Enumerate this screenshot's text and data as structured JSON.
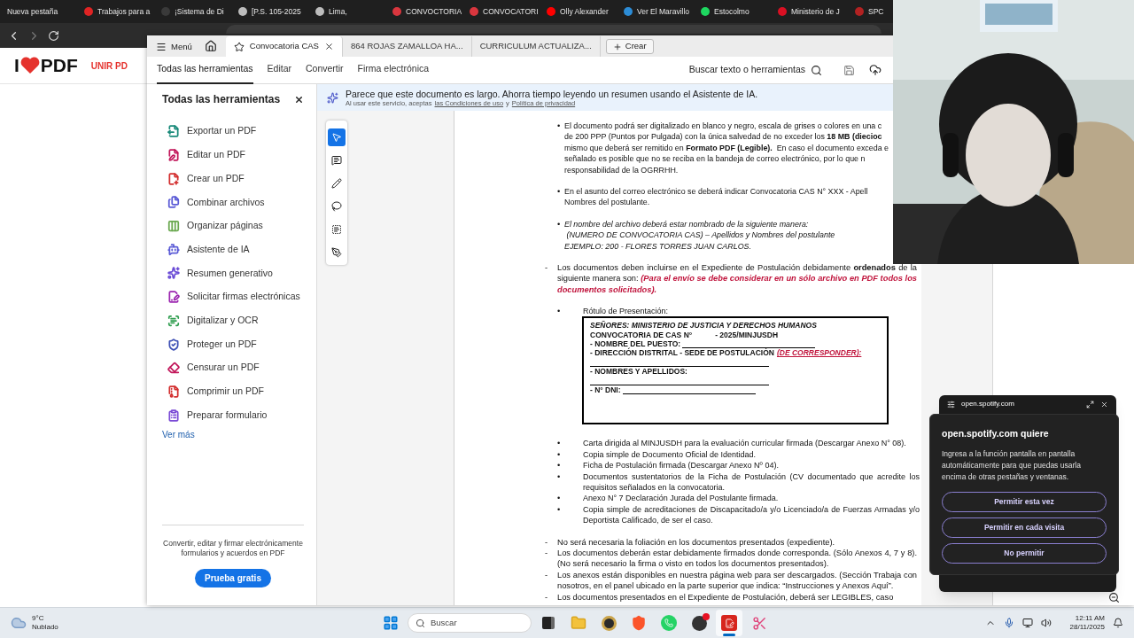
{
  "browser_tabs": [
    {
      "label": "Nueva pestaña"
    },
    {
      "label": "Trabajos para a",
      "color": "#e02424"
    },
    {
      "label": "¡Sistema de Di",
      "color": "#3a3a3a"
    },
    {
      "label": "[P.S. 105-2025",
      "color": "#bdbdbd"
    },
    {
      "label": "Lima,",
      "color": "#bdbdbd"
    },
    {
      "label": "CONVOCTORIA",
      "color": "#d9363e"
    },
    {
      "label": "CONVOCATORI",
      "color": "#d9363e"
    },
    {
      "label": "Olly Alexander",
      "color": "#ff0000"
    },
    {
      "label": "Ver El Maravillo",
      "color": "#2c8cd6"
    },
    {
      "label": "Estocolmo",
      "color": "#1ed760"
    },
    {
      "label": "Ministerio de J",
      "color": "#d91023"
    },
    {
      "label": "SPC",
      "color": "#b22222"
    }
  ],
  "site": {
    "logo_left": "I",
    "logo_right": "PDF",
    "nav_item": "UNIR PD"
  },
  "acrobat": {
    "menu_label": "Menú",
    "tabs": [
      {
        "label": "Convocatoria CAS",
        "selected": true
      },
      {
        "label": "864 ROJAS ZAMALLOA HA...",
        "selected": false
      },
      {
        "label": "CURRICULUM ACTUALIZA...",
        "selected": false
      }
    ],
    "create_button": "Crear",
    "toolbar_tabs": [
      {
        "label": "Todas las herramientas",
        "selected": true
      },
      {
        "label": "Editar",
        "selected": false
      },
      {
        "label": "Convertir",
        "selected": false
      },
      {
        "label": "Firma electrónica",
        "selected": false
      }
    ],
    "search_label": "Buscar texto o herramientas"
  },
  "sidebar": {
    "title": "Todas las herramientas",
    "items": [
      {
        "label": "Exportar un PDF",
        "kind": "export",
        "color": "#1a8a7a"
      },
      {
        "label": "Editar un PDF",
        "kind": "edit",
        "color": "#c2185b"
      },
      {
        "label": "Crear un PDF",
        "kind": "create",
        "color": "#d32f2f"
      },
      {
        "label": "Combinar archivos",
        "kind": "combine",
        "color": "#5b5bd6"
      },
      {
        "label": "Organizar páginas",
        "kind": "organize",
        "color": "#6aa84f"
      },
      {
        "label": "Asistente de IA",
        "kind": "assistant",
        "color": "#5b5bd6"
      },
      {
        "label": "Resumen generativo",
        "kind": "summary",
        "color": "#6a4bd6"
      },
      {
        "label": "Solicitar firmas electrónicas",
        "kind": "sign",
        "color": "#9c27b0"
      },
      {
        "label": "Digitalizar y OCR",
        "kind": "scan",
        "color": "#2e9d4e"
      },
      {
        "label": "Proteger un PDF",
        "kind": "protect",
        "color": "#3f51b5"
      },
      {
        "label": "Censurar un PDF",
        "kind": "redact",
        "color": "#c2185b"
      },
      {
        "label": "Comprimir un PDF",
        "kind": "compress",
        "color": "#d32f2f"
      },
      {
        "label": "Preparar formulario",
        "kind": "form",
        "color": "#7b4bd6"
      }
    ],
    "more_link": "Ver más",
    "promo": "Convertir, editar y firmar electrónicamente formularios y acuerdos en PDF",
    "cta": "Prueba gratis"
  },
  "banner": {
    "message": "Parece que este documento es largo. Ahorra tiempo leyendo un resumen usando el Asistente de IA.",
    "notice": "Al usar este servicio, aceptas",
    "terms_link": "las Condiciones de uso",
    "conjunction": "y",
    "privacy_link": "Política de privacidad"
  },
  "tool_rail": [
    {
      "kind": "select",
      "selected": true
    },
    {
      "kind": "comment",
      "selected": false
    },
    {
      "kind": "draw",
      "selected": false
    },
    {
      "kind": "lasso",
      "selected": false
    },
    {
      "kind": "text",
      "selected": false
    },
    {
      "kind": "sign",
      "selected": false
    }
  ],
  "document": {
    "blocks": [
      {
        "kind": "dot",
        "marker": "•",
        "lines": [
          "El documento podrá ser digitalizado en blanco y negro, escala de grises o colores en una c",
          "de 200 PPP (Puntos por Pulgada) con la única salvedad de no exceder los **18 MB (diecioc**",
          "mismo que deberá ser remitido en **Formato PDF (Legible).**  En caso el documento exceda e",
          "señalado es posible que no se reciba en la bandeja de correo electrónico, por lo que n",
          "responsabilidad de la OGRRHH."
        ]
      },
      {
        "kind": "dot",
        "marker": "•",
        "lines": [
          "En el asunto del correo electrónico se deberá indicar Convocatoria CAS N° XXX - Apell",
          "Nombres del postulante."
        ]
      },
      {
        "kind": "dot",
        "marker": "•",
        "italic": true,
        "lines": [
          "El nombre del archivo deberá estar nombrado de la siguiente manera:",
          " (NUMERO DE CONVOCATORIA CAS) – Apellidos y Nombres del postulante",
          "EJEMPLO: 200 - FLORES TORRES JUAN CARLOS."
        ]
      },
      {
        "kind": "dash",
        "marker": "-",
        "lines": [
          "Los documentos deben incluirse en el Expediente de Postulación debidamente **ordenados** de la",
          {
            "text": "siguiente manera son: ",
            "alert": "(Para el envío se debe considerar en un sólo archivo en PDF todos los"
          },
          {
            "alert": "documentos solicitados)."
          }
        ]
      },
      {
        "kind": "item",
        "marker": "•",
        "lines": [
          "Rótulo de Presentación:"
        ]
      },
      {
        "kind": "label_box",
        "rows": [
          {
            "text": "SEÑORES: MINISTERIO DE JUSTICIA Y DERECHOS HUMANOS",
            "italic": true
          },
          {
            "text": "CONVOCATORIA DE CAS N°",
            "suffix": "- 2025/MINJUSDH"
          },
          {
            "text": "- NOMBRE DEL PUESTO:",
            "fill_line": true
          },
          {
            "text": "- DIRECCIÓN DISTRITAL - SEDE DE POSTULACIÓN",
            "alert": "(DE CORRESPONDER):"
          },
          {
            "fill_line": true
          },
          {
            "text": "- NOMBRES Y APELLIDOS:"
          },
          {
            "fill_line": true
          },
          {
            "text": "- N° DNI:",
            "fill_line": true
          }
        ]
      },
      {
        "kind": "item",
        "marker": "•",
        "lines": [
          "Carta dirigida al MINJUSDH para la evaluación curricular firmada (Descargar Anexo N° 08)."
        ]
      },
      {
        "kind": "item",
        "marker": "•",
        "lines": [
          "Copia simple de Documento Oficial de Identidad."
        ]
      },
      {
        "kind": "item",
        "marker": "•",
        "lines": [
          "Ficha de Postulación firmada (Descargar Anexo Nº 04)."
        ]
      },
      {
        "kind": "item",
        "marker": "•",
        "lines": [
          "Documentos sustentatorios de la Ficha de Postulación (CV documentado que acredite los",
          "requisitos señalados en la convocatoria."
        ]
      },
      {
        "kind": "item",
        "marker": "•",
        "lines": [
          "Anexo N° 7 Declaración Jurada del Postulante firmada."
        ]
      },
      {
        "kind": "item",
        "marker": "•",
        "lines": [
          "Copia simple de acreditaciones de Discapacitado/a y/o Licenciado/a de Fuerzas Armadas y/o",
          "Deportista Calificado, de ser el caso."
        ]
      },
      {
        "kind": "dash",
        "marker": "-",
        "lines": [
          "No será necesaria la foliación en los documentos presentados (expediente)."
        ]
      },
      {
        "kind": "dash",
        "marker": "-",
        "lines": [
          "Los documentos deberán estar debidamente firmados donde corresponda. (Sólo Anexos 4, 7 y 8).",
          "(No será necesario la firma o visto en todos los documentos presentados)."
        ]
      },
      {
        "kind": "dash",
        "marker": "-",
        "lines": [
          "Los anexos están disponibles en nuestra página web para ser descargados. (Sección Trabaja con",
          "nosotros, en el panel ubicado en la parte superior que indica: “Instrucciones y Anexos Aquí”."
        ]
      },
      {
        "kind": "dash",
        "marker": "-",
        "lines": [
          "Los documentos presentados en el Expediente de Postulación, deberá ser LEGIBLES, caso"
        ]
      }
    ]
  },
  "popup": {
    "origin": "open.spotify.com",
    "title": "open.spotify.com quiere",
    "body": "Ingresa a la función pantalla en pantalla automáticamente para que puedas usarla encima de otras pestañas y ventanas.",
    "buttons": [
      "Permitir esta vez",
      "Permitir en cada visita",
      "No permitir"
    ]
  },
  "taskbar": {
    "temperature": "9°C",
    "condition": "Nublado",
    "search_placeholder": "Buscar",
    "apps": [
      {
        "kind": "taskview",
        "active": false
      },
      {
        "kind": "folder",
        "active": false
      },
      {
        "kind": "disc",
        "active": false
      },
      {
        "kind": "brave",
        "active": false
      },
      {
        "kind": "whatsapp",
        "active": false
      },
      {
        "kind": "obs",
        "active": false
      },
      {
        "kind": "acrobat",
        "active": true
      },
      {
        "kind": "snip",
        "active": false
      }
    ],
    "time": "12:11 AM",
    "date": "28/11/2025"
  }
}
